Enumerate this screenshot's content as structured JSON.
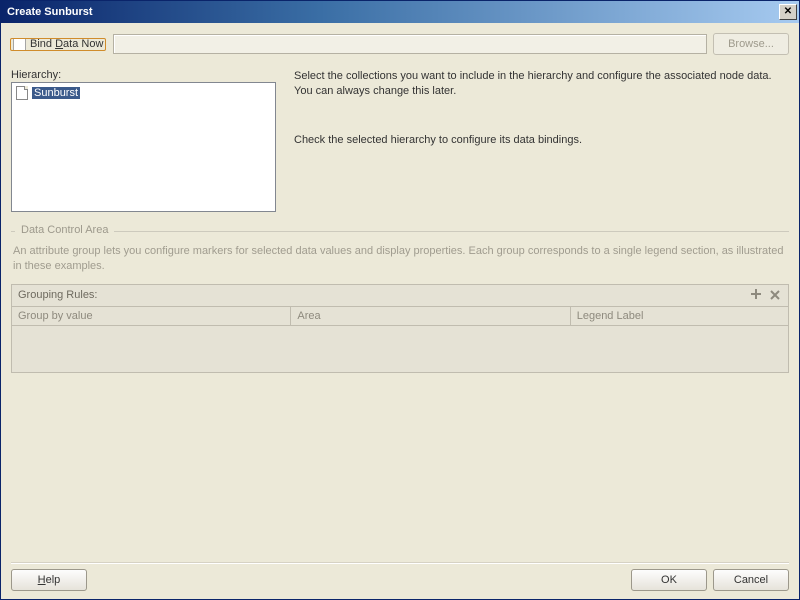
{
  "window": {
    "title": "Create Sunburst"
  },
  "bind": {
    "checkbox_label_pre": "Bind ",
    "checkbox_mnemonic": "D",
    "checkbox_label_post": "ata Now",
    "browse_label": "Browse...",
    "path_value": ""
  },
  "hierarchy": {
    "label": "Hierarchy:",
    "items": [
      {
        "name": "Sunburst",
        "selected": true
      }
    ]
  },
  "instructions": {
    "p1": "Select the collections you want to include in the hierarchy and configure the associated node data. You can always change this later.",
    "p2": "Check the selected hierarchy to configure its data bindings."
  },
  "data_control": {
    "title": "Data Control Area",
    "desc": "An attribute group lets you configure markers for selected data values and display properties. Each group corresponds to a single legend section, as illustrated in these examples."
  },
  "grouping": {
    "title": "Grouping Rules:",
    "columns": {
      "c1": "Group by value",
      "c2": "Area",
      "c3": "Legend Label"
    },
    "rows": []
  },
  "footer": {
    "help_mnemonic": "H",
    "help_post": "elp",
    "ok": "OK",
    "cancel": "Cancel"
  }
}
